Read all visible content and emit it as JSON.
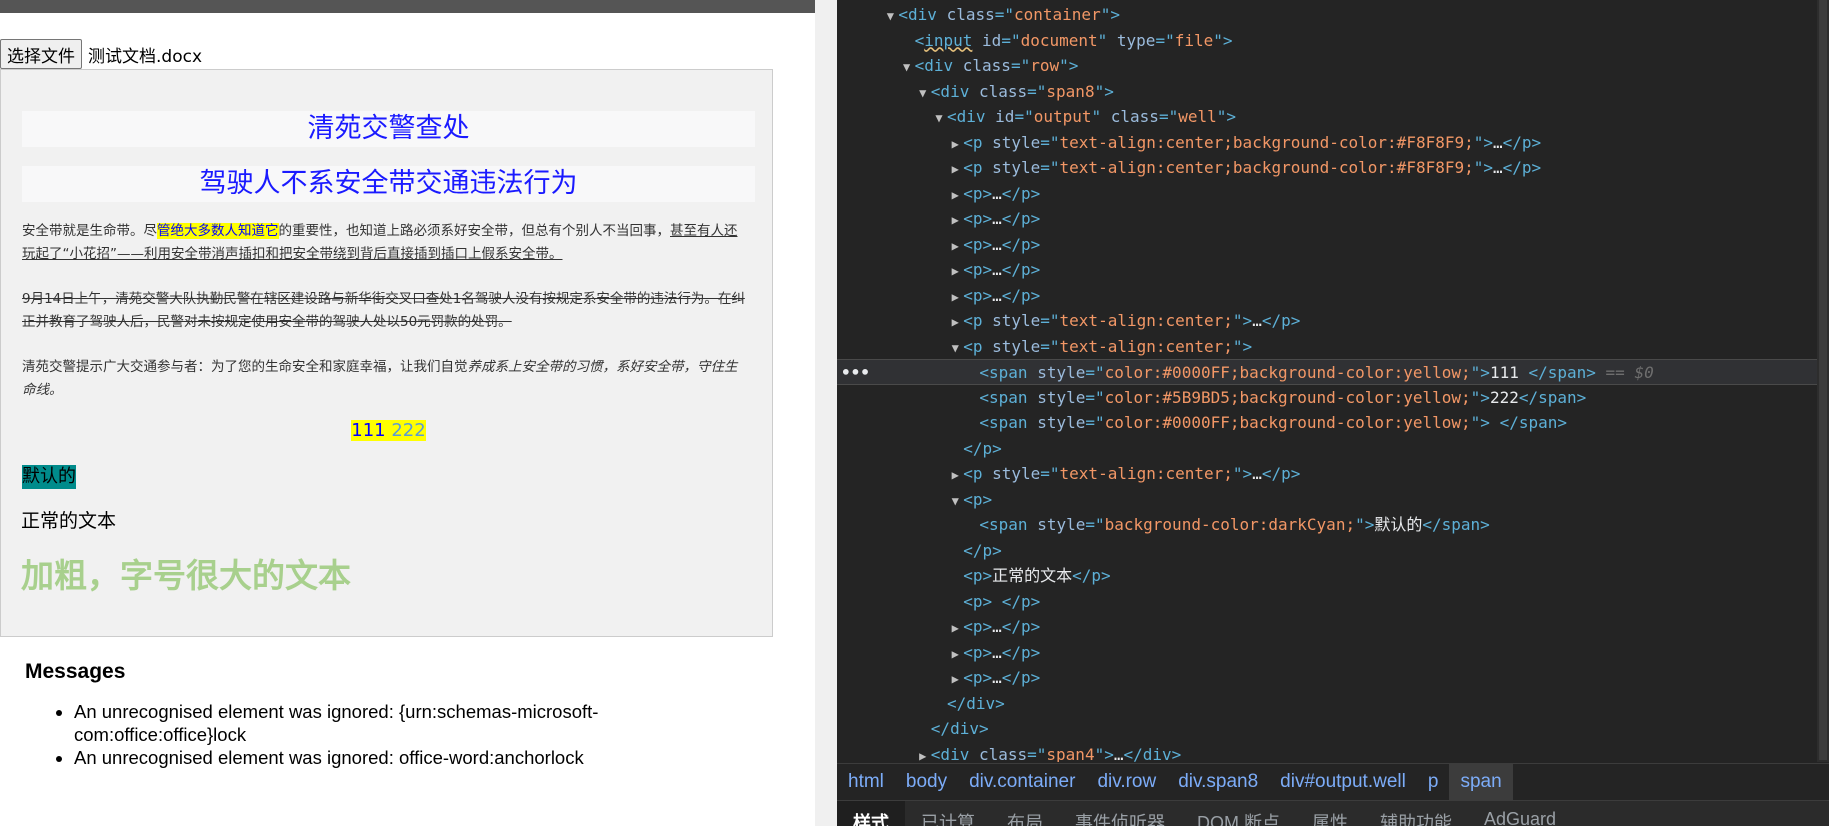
{
  "page": {
    "file_button": "选择文件",
    "file_name": "测试文档.docx",
    "title_1": "清苑交警查处",
    "title_2": "驾驶人不系安全带交通违法行为",
    "para_1": {
      "a": "安全带就是生命带。尽",
      "b": "管绝大多数人知道它",
      "c": "的重要性，也知道上路必须系好安全带，但总有个别人不当回事，",
      "d": "甚至有人还玩起了“小花招”——利用安全带消声插扣和把安全带绕到背后直接插到插口上假系安全带。"
    },
    "para_2": "9月14日上午，清苑交警大队执勤民警在辖区建设路与新华街交叉口查处1名驾驶人没有按规定系安全带的违法行为。在纠正并教育了驾驶人后，民警对未按规定使用安全带的驾驶人处以50元罚款的处罚。",
    "para_3": {
      "a": "清苑交警提示广大交通参与者：为了您的生命安全和家庭幸福，让我们自觉",
      "b": "养成系上安全带的习惯，系好安全带，守住生命线。"
    },
    "span_111": "111 ",
    "span_222": "222",
    "span_blank": " ",
    "darkcyan_text": "默认的",
    "normal_text": "正常的文本",
    "big_text": "加粗，字号很大的文本",
    "messages_title": "Messages",
    "messages": [
      "An unrecognised element was ignored: {urn:schemas-microsoft-com:office:office}lock",
      "An unrecognised element was ignored: office-word:anchorlock"
    ]
  },
  "devtools": {
    "lines": [
      {
        "indent": 3,
        "tri": "down",
        "parts": [
          [
            "tg",
            "<div "
          ],
          [
            "an",
            "class"
          ],
          [
            "tg",
            "=\""
          ],
          [
            "av",
            "container"
          ],
          [
            "tg",
            "\">"
          ]
        ]
      },
      {
        "indent": 4,
        "tri": "",
        "parts": [
          [
            "tg",
            "<"
          ],
          [
            "tgsq",
            "input"
          ],
          [
            "tg",
            " "
          ],
          [
            "an",
            "id"
          ],
          [
            "tg",
            "=\""
          ],
          [
            "av",
            "document"
          ],
          [
            "tg",
            "\" "
          ],
          [
            "an",
            "type"
          ],
          [
            "tg",
            "=\""
          ],
          [
            "av",
            "file"
          ],
          [
            "tg",
            "\">"
          ]
        ]
      },
      {
        "indent": 4,
        "tri": "down",
        "parts": [
          [
            "tg",
            "<div "
          ],
          [
            "an",
            "class"
          ],
          [
            "tg",
            "=\""
          ],
          [
            "av",
            "row"
          ],
          [
            "tg",
            "\">"
          ]
        ]
      },
      {
        "indent": 5,
        "tri": "down",
        "parts": [
          [
            "tg",
            "<div "
          ],
          [
            "an",
            "class"
          ],
          [
            "tg",
            "=\""
          ],
          [
            "av",
            "span8"
          ],
          [
            "tg",
            "\">"
          ]
        ]
      },
      {
        "indent": 6,
        "tri": "down",
        "parts": [
          [
            "tg",
            "<div "
          ],
          [
            "an",
            "id"
          ],
          [
            "tg",
            "=\""
          ],
          [
            "av",
            "output"
          ],
          [
            "tg",
            "\" "
          ],
          [
            "an",
            "class"
          ],
          [
            "tg",
            "=\""
          ],
          [
            "av",
            "well"
          ],
          [
            "tg",
            "\">"
          ]
        ]
      },
      {
        "indent": 7,
        "tri": "right",
        "parts": [
          [
            "tg",
            "<p "
          ],
          [
            "an",
            "style"
          ],
          [
            "tg",
            "=\""
          ],
          [
            "av",
            "text-align:center;background-color:#F8F8F9;"
          ],
          [
            "tg",
            "\">"
          ],
          [
            "tx",
            "…"
          ],
          [
            "tg",
            "</p>"
          ]
        ]
      },
      {
        "indent": 7,
        "tri": "right",
        "parts": [
          [
            "tg",
            "<p "
          ],
          [
            "an",
            "style"
          ],
          [
            "tg",
            "=\""
          ],
          [
            "av",
            "text-align:center;background-color:#F8F8F9;"
          ],
          [
            "tg",
            "\">"
          ],
          [
            "tx",
            "…"
          ],
          [
            "tg",
            "</p>"
          ]
        ]
      },
      {
        "indent": 7,
        "tri": "right",
        "parts": [
          [
            "tg",
            "<p>"
          ],
          [
            "tx",
            "…"
          ],
          [
            "tg",
            "</p>"
          ]
        ]
      },
      {
        "indent": 7,
        "tri": "right",
        "parts": [
          [
            "tg",
            "<p>"
          ],
          [
            "tx",
            "…"
          ],
          [
            "tg",
            "</p>"
          ]
        ]
      },
      {
        "indent": 7,
        "tri": "right",
        "parts": [
          [
            "tg",
            "<p>"
          ],
          [
            "tx",
            "…"
          ],
          [
            "tg",
            "</p>"
          ]
        ]
      },
      {
        "indent": 7,
        "tri": "right",
        "parts": [
          [
            "tg",
            "<p>"
          ],
          [
            "tx",
            "…"
          ],
          [
            "tg",
            "</p>"
          ]
        ]
      },
      {
        "indent": 7,
        "tri": "right",
        "parts": [
          [
            "tg",
            "<p>"
          ],
          [
            "tx",
            "…"
          ],
          [
            "tg",
            "</p>"
          ]
        ]
      },
      {
        "indent": 7,
        "tri": "right",
        "parts": [
          [
            "tg",
            "<p "
          ],
          [
            "an",
            "style"
          ],
          [
            "tg",
            "=\""
          ],
          [
            "av",
            "text-align:center;"
          ],
          [
            "tg",
            "\">"
          ],
          [
            "tx",
            "…"
          ],
          [
            "tg",
            "</p>"
          ]
        ]
      },
      {
        "indent": 7,
        "tri": "down",
        "parts": [
          [
            "tg",
            "<p "
          ],
          [
            "an",
            "style"
          ],
          [
            "tg",
            "=\""
          ],
          [
            "av",
            "text-align:center;"
          ],
          [
            "tg",
            "\">"
          ]
        ]
      },
      {
        "indent": 8,
        "tri": "",
        "selected": true,
        "parts": [
          [
            "tg",
            "<span "
          ],
          [
            "an",
            "style"
          ],
          [
            "tg",
            "=\""
          ],
          [
            "av",
            "color:#0000FF;background-color:yellow;"
          ],
          [
            "tg",
            "\">"
          ],
          [
            "tx",
            "111 "
          ],
          [
            "tg",
            "</span>"
          ],
          [
            "dim",
            " == $0"
          ]
        ]
      },
      {
        "indent": 8,
        "tri": "",
        "parts": [
          [
            "tg",
            "<span "
          ],
          [
            "an",
            "style"
          ],
          [
            "tg",
            "=\""
          ],
          [
            "av",
            "color:#5B9BD5;background-color:yellow;"
          ],
          [
            "tg",
            "\">"
          ],
          [
            "tx",
            "222"
          ],
          [
            "tg",
            "</span>"
          ]
        ]
      },
      {
        "indent": 8,
        "tri": "",
        "parts": [
          [
            "tg",
            "<span "
          ],
          [
            "an",
            "style"
          ],
          [
            "tg",
            "=\""
          ],
          [
            "av",
            "color:#0000FF;background-color:yellow;"
          ],
          [
            "tg",
            "\">"
          ],
          [
            "tx",
            " "
          ],
          [
            "tg",
            "</span>"
          ]
        ]
      },
      {
        "indent": 7,
        "tri": "",
        "parts": [
          [
            "tg",
            "</p>"
          ]
        ]
      },
      {
        "indent": 7,
        "tri": "right",
        "parts": [
          [
            "tg",
            "<p "
          ],
          [
            "an",
            "style"
          ],
          [
            "tg",
            "=\""
          ],
          [
            "av",
            "text-align:center;"
          ],
          [
            "tg",
            "\">"
          ],
          [
            "tx",
            "…"
          ],
          [
            "tg",
            "</p>"
          ]
        ]
      },
      {
        "indent": 7,
        "tri": "down",
        "parts": [
          [
            "tg",
            "<p>"
          ]
        ]
      },
      {
        "indent": 8,
        "tri": "",
        "parts": [
          [
            "tg",
            "<span "
          ],
          [
            "an",
            "style"
          ],
          [
            "tg",
            "=\""
          ],
          [
            "av",
            "background-color:darkCyan;"
          ],
          [
            "tg",
            "\">"
          ],
          [
            "tx",
            "默认的"
          ],
          [
            "tg",
            "</span>"
          ]
        ]
      },
      {
        "indent": 7,
        "tri": "",
        "parts": [
          [
            "tg",
            "</p>"
          ]
        ]
      },
      {
        "indent": 7,
        "tri": "",
        "parts": [
          [
            "tg",
            "<p>"
          ],
          [
            "tx",
            "正常的文本"
          ],
          [
            "tg",
            "</p>"
          ]
        ]
      },
      {
        "indent": 7,
        "tri": "",
        "parts": [
          [
            "tg",
            "<p>"
          ],
          [
            "tx",
            " "
          ],
          [
            "tg",
            "</p>"
          ]
        ]
      },
      {
        "indent": 7,
        "tri": "right",
        "parts": [
          [
            "tg",
            "<p>"
          ],
          [
            "tx",
            "…"
          ],
          [
            "tg",
            "</p>"
          ]
        ]
      },
      {
        "indent": 7,
        "tri": "right",
        "parts": [
          [
            "tg",
            "<p>"
          ],
          [
            "tx",
            "…"
          ],
          [
            "tg",
            "</p>"
          ]
        ]
      },
      {
        "indent": 7,
        "tri": "right",
        "parts": [
          [
            "tg",
            "<p>"
          ],
          [
            "tx",
            "…"
          ],
          [
            "tg",
            "</p>"
          ]
        ]
      },
      {
        "indent": 6,
        "tri": "",
        "parts": [
          [
            "tg",
            "</div>"
          ]
        ]
      },
      {
        "indent": 5,
        "tri": "",
        "parts": [
          [
            "tg",
            "</div>"
          ]
        ]
      },
      {
        "indent": 5,
        "tri": "right",
        "parts": [
          [
            "tg",
            "<div "
          ],
          [
            "an",
            "class"
          ],
          [
            "tg",
            "=\""
          ],
          [
            "av",
            "span4"
          ],
          [
            "tg",
            "\">"
          ],
          [
            "tx",
            "…"
          ],
          [
            "tg",
            "</div>"
          ]
        ]
      }
    ],
    "selected_dots": "•••",
    "breadcrumbs": [
      "html",
      "body",
      "div.container",
      "div.row",
      "div.span8",
      "div#output.well",
      "p",
      "span"
    ],
    "tabs": [
      "样式",
      "已计算",
      "布局",
      "事件侦听器",
      "DOM 断点",
      "属性",
      "辅助功能",
      "AdGuard"
    ]
  }
}
